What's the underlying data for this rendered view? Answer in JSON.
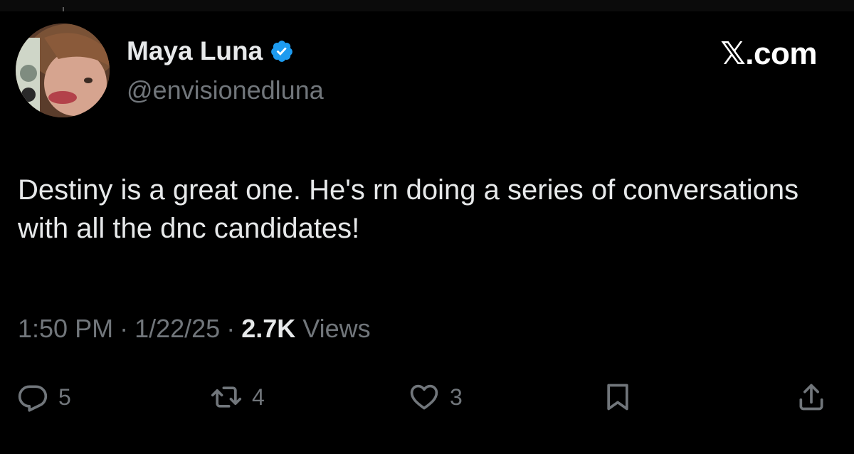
{
  "author": {
    "name": "Maya Luna",
    "handle": "@envisionedluna",
    "verified_color": "#1d9bf0"
  },
  "brand": {
    "label": "𝕏.com"
  },
  "tweet": {
    "text": "Destiny is a great one. He's rn doing a series of conversations with all the dnc candidates!"
  },
  "meta": {
    "time": "1:50 PM",
    "date": "1/22/25",
    "separator": "·",
    "views_count": "2.7K",
    "views_label": "Views"
  },
  "actions": {
    "reply": {
      "icon": "reply-icon",
      "count": "5"
    },
    "retweet": {
      "icon": "retweet-icon",
      "count": "4"
    },
    "like": {
      "icon": "heart-icon",
      "count": "3"
    },
    "bookmark": {
      "icon": "bookmark-icon"
    },
    "share": {
      "icon": "share-icon"
    }
  },
  "colors": {
    "background": "#000000",
    "primary_text": "#e7e9ea",
    "secondary_text": "#71767b",
    "accent": "#1d9bf0"
  }
}
